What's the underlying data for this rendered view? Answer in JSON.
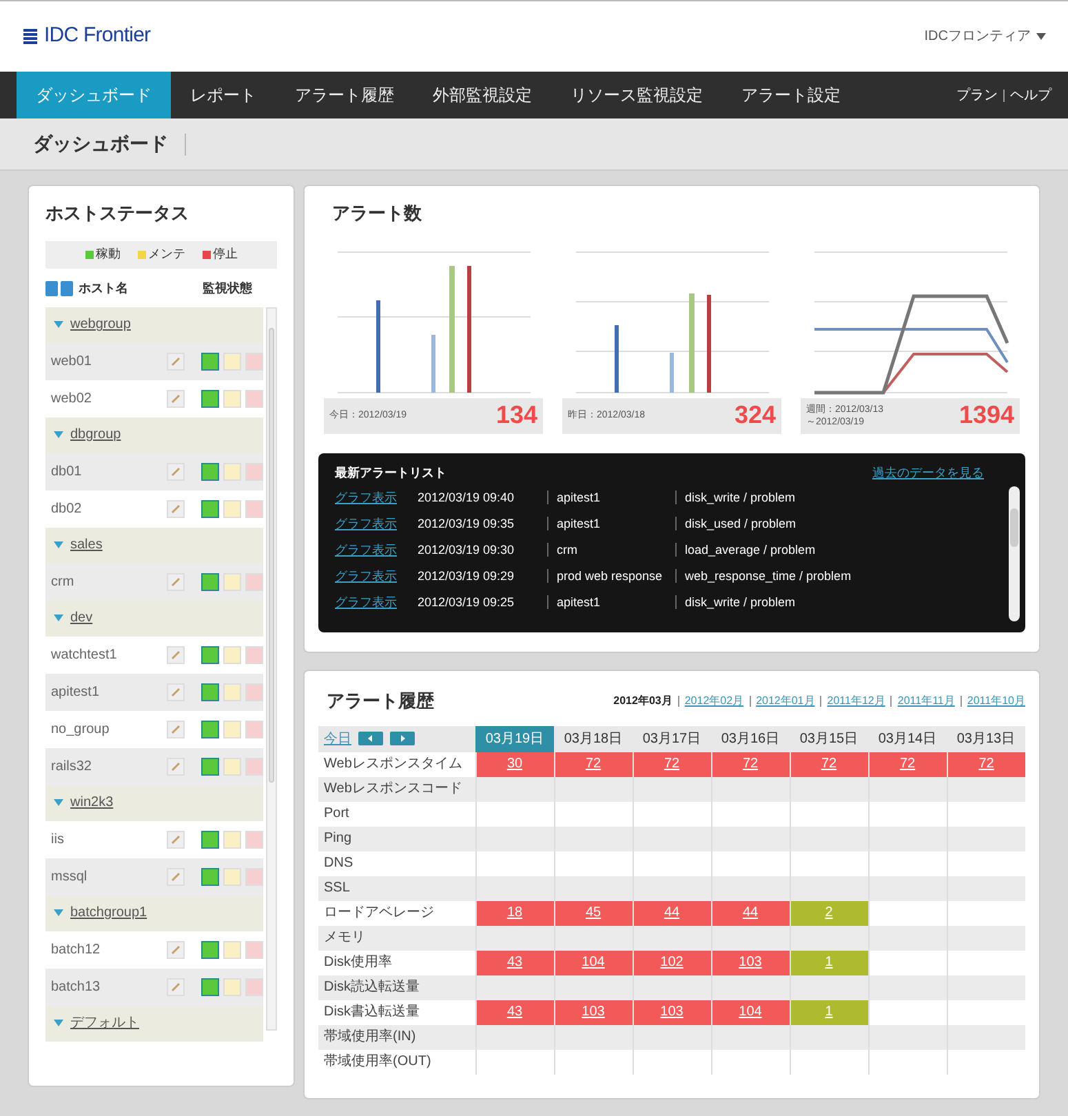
{
  "header": {
    "logo": "IDC Frontier",
    "user_menu": "IDCフロンティア",
    "links": [
      "プラン",
      "ヘルプ"
    ]
  },
  "nav": [
    {
      "label": "ダッシュボード",
      "selected": true
    },
    {
      "label": "レポート",
      "selected": false
    },
    {
      "label": "アラート履歴",
      "selected": false
    },
    {
      "label": "外部監視設定",
      "selected": false
    },
    {
      "label": "リソース監視設定",
      "selected": false
    },
    {
      "label": "アラート設定",
      "selected": false
    }
  ],
  "breadcrumb": "ダッシュボード",
  "host_status": {
    "title": "ホストステータス",
    "legend": [
      {
        "label": "稼動",
        "color": "#5cc83c"
      },
      {
        "label": "メンテ",
        "color": "#f2d64a"
      },
      {
        "label": "停止",
        "color": "#e8464a"
      }
    ],
    "columns": [
      "ホスト名",
      "監視状態"
    ],
    "groups": [
      {
        "name": "webgroup",
        "expanded": true,
        "children": [
          {
            "name": "web01",
            "active": true
          },
          {
            "name": "web02",
            "active": true
          }
        ]
      },
      {
        "name": "dbgroup",
        "expanded": true,
        "children": [
          {
            "name": "db01",
            "active": true
          },
          {
            "name": "db02",
            "active": true
          }
        ]
      },
      {
        "name": "sales",
        "expanded": true,
        "children": [
          {
            "name": "crm",
            "active": true
          }
        ]
      },
      {
        "name": "dev",
        "expanded": true,
        "children": [
          {
            "name": "watchtest1",
            "active": true
          },
          {
            "name": "apitest1",
            "active": true
          },
          {
            "name": "no_group",
            "active": true
          },
          {
            "name": "rails32",
            "active": true
          }
        ]
      },
      {
        "name": "win2k3",
        "expanded": true,
        "children": [
          {
            "name": "iis",
            "active": true
          },
          {
            "name": "mssql",
            "active": true
          }
        ]
      },
      {
        "name": "batchgroup1",
        "expanded": true,
        "children": [
          {
            "name": "batch12",
            "active": true
          },
          {
            "name": "batch13",
            "active": true
          }
        ]
      },
      {
        "name": "デフォルト",
        "expanded": true
      }
    ]
  },
  "alert_count": {
    "title": "アラート数",
    "charts": [
      {
        "kind": "bar",
        "period": [
          "今日：2012/03/19"
        ],
        "count": "134"
      },
      {
        "kind": "bar2",
        "period": [
          "昨日：2012/03/18"
        ],
        "count": "324"
      },
      {
        "kind": "line",
        "period": [
          "週間：2012/03/13",
          "～2012/03/19"
        ],
        "count": "1394"
      }
    ],
    "latest": {
      "title": "最新アラートリスト",
      "more_link": "過去のデータを見る",
      "rows": [
        {
          "link": "グラフ表示",
          "time": "2012/03/19 09:40",
          "host": "apitest1",
          "event": "disk_write / problem"
        },
        {
          "link": "グラフ表示",
          "time": "2012/03/19 09:35",
          "host": "apitest1",
          "event": "disk_used / problem"
        },
        {
          "link": "グラフ表示",
          "time": "2012/03/19 09:30",
          "host": "crm",
          "event": "load_average / problem"
        },
        {
          "link": "グラフ表示",
          "time": "2012/03/19 09:29",
          "host": "prod web response",
          "event": "web_response_time / problem"
        },
        {
          "link": "グラフ表示",
          "time": "2012/03/19 09:25",
          "host": "apitest1",
          "event": "disk_write / problem"
        }
      ]
    }
  },
  "alert_history": {
    "title": "アラート履歴",
    "months": [
      {
        "label": "2012年03月",
        "selected": true
      },
      {
        "label": "2012年02月",
        "selected": false
      },
      {
        "label": "2012年01月",
        "selected": false
      },
      {
        "label": "2011年12月",
        "selected": false
      },
      {
        "label": "2011年11月",
        "selected": false
      },
      {
        "label": "2011年10月",
        "selected": false
      }
    ],
    "today_link": "今日",
    "dates": [
      {
        "label": "03月19日",
        "selected": true
      },
      {
        "label": "03月18日",
        "selected": false
      },
      {
        "label": "03月17日",
        "selected": false
      },
      {
        "label": "03月16日",
        "selected": false
      },
      {
        "label": "03月15日",
        "selected": false
      },
      {
        "label": "03月14日",
        "selected": false
      },
      {
        "label": "03月13日",
        "selected": false
      }
    ],
    "rows": [
      {
        "label": "Webレスポンスタイム",
        "cells": [
          {
            "value": "30",
            "color": "#f25a5a"
          },
          {
            "value": "72",
            "color": "#f25a5a"
          },
          {
            "value": "72",
            "color": "#f25a5a"
          },
          {
            "value": "72",
            "color": "#f25a5a"
          },
          {
            "value": "72",
            "color": "#f25a5a"
          },
          {
            "value": "72",
            "color": "#f25a5a"
          },
          {
            "value": "72",
            "color": "#f25a5a"
          }
        ]
      },
      {
        "label": "Webレスポンスコード"
      },
      {
        "label": "Port"
      },
      {
        "label": "Ping"
      },
      {
        "label": "DNS"
      },
      {
        "label": "SSL"
      },
      {
        "label": "ロードアベレージ",
        "cells": [
          {
            "value": "18",
            "color": "#f25a5a"
          },
          {
            "value": "45",
            "color": "#f25a5a"
          },
          {
            "value": "44",
            "color": "#f25a5a"
          },
          {
            "value": "44",
            "color": "#f25a5a"
          },
          {
            "value": "2",
            "color": "#aebb2e"
          }
        ]
      },
      {
        "label": "メモリ"
      },
      {
        "label": "Disk使用率",
        "cells": [
          {
            "value": "43",
            "color": "#f25a5a"
          },
          {
            "value": "104",
            "color": "#f25a5a"
          },
          {
            "value": "102",
            "color": "#f25a5a"
          },
          {
            "value": "103",
            "color": "#f25a5a"
          },
          {
            "value": "1",
            "color": "#aebb2e"
          }
        ]
      },
      {
        "label": "Disk読込転送量"
      },
      {
        "label": "Disk書込転送量",
        "cells": [
          {
            "value": "43",
            "color": "#f25a5a"
          },
          {
            "value": "103",
            "color": "#f25a5a"
          },
          {
            "value": "103",
            "color": "#f25a5a"
          },
          {
            "value": "104",
            "color": "#f25a5a"
          },
          {
            "value": "1",
            "color": "#aebb2e"
          }
        ]
      },
      {
        "label": "帯域使用率(IN)"
      },
      {
        "label": "帯域使用率(OUT)"
      }
    ]
  }
}
